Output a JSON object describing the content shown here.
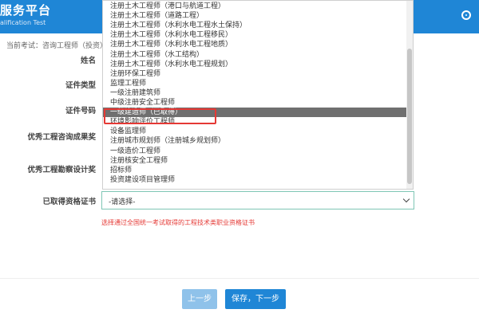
{
  "header": {
    "title": "服务平台",
    "subtitle": "alification Test"
  },
  "form": {
    "exam_line": "当前考试：咨询工程师（投资）",
    "labels": {
      "name": "姓名",
      "id_type": "证件类型",
      "id_number": "证件号码",
      "consult_award": "优秀工程咨询成果奖",
      "survey_award": "优秀工程勘察设计奖",
      "certificate": "已取得资格证书"
    },
    "certificate_select": {
      "value": "-请选择-"
    },
    "hint": "选择通过全国统一考试取得的工程技术类职业资格证书"
  },
  "dropdown": {
    "options": [
      "注册土木工程师（港口与航道工程）",
      "注册土木工程师（道路工程）",
      "注册土木工程师（水利水电工程水土保持）",
      "注册土木工程师（水利水电工程移民）",
      "注册土木工程师（水利水电工程地质）",
      "注册土木工程师（水工结构）",
      "注册土木工程师（水利水电工程规划）",
      "注册环保工程师",
      "监理工程师",
      "一级注册建筑师",
      "中级注册安全工程师",
      "一级建造师（已取得）",
      "环境影响评价工程师",
      "设备监理师",
      "注册城市规划师（注册城乡规划师）",
      "一级造价工程师",
      "注册核安全工程师",
      "招标师",
      "投资建设项目管理师"
    ],
    "selected_index": 11
  },
  "buttons": {
    "prev": "上一步",
    "next": "保存，下一步"
  }
}
